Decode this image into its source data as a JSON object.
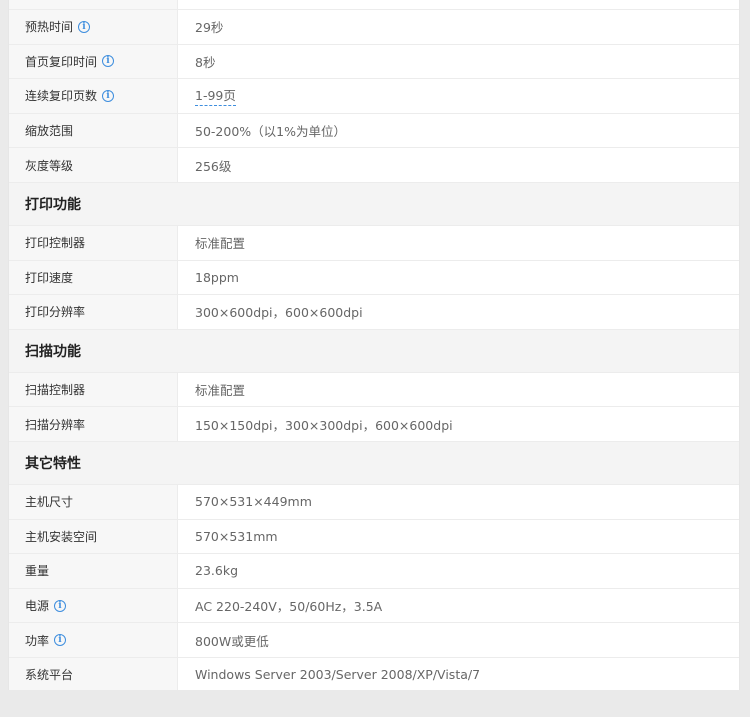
{
  "sections": {
    "copy_rows": [
      {
        "label": "预热时间",
        "value": "29秒",
        "info": true
      },
      {
        "label": "首页复印时间",
        "value": "8秒",
        "info": true
      },
      {
        "label": "连续复印页数",
        "value": "1-99页",
        "info": true
      },
      {
        "label": "缩放范围",
        "value": "50-200%（以1%为单位）",
        "info": false
      },
      {
        "label": "灰度等级",
        "value": "256级",
        "info": false
      }
    ],
    "print_title": "打印功能",
    "print_rows": [
      {
        "label": "打印控制器",
        "value": "标准配置"
      },
      {
        "label": "打印速度",
        "value": "18ppm"
      },
      {
        "label": "打印分辨率",
        "value": "300×600dpi，600×600dpi"
      }
    ],
    "scan_title": "扫描功能",
    "scan_rows": [
      {
        "label": "扫描控制器",
        "value": "标准配置"
      },
      {
        "label": "扫描分辨率",
        "value": "150×150dpi，300×300dpi，600×600dpi"
      }
    ],
    "other_title": "其它特性",
    "other_rows": [
      {
        "label": "主机尺寸",
        "value": "570×531×449mm",
        "info": false
      },
      {
        "label": "主机安装空间",
        "value": "570×531mm",
        "info": false
      },
      {
        "label": "重量",
        "value": "23.6kg",
        "info": false
      },
      {
        "label": "电源",
        "value": "AC 220-240V，50/60Hz，3.5A",
        "info": true
      },
      {
        "label": "功率",
        "value": "800W或更低",
        "info": true
      },
      {
        "label": "系统平台",
        "value": "Windows Server 2003/Server 2008/XP/Vista/7",
        "info": false
      }
    ]
  },
  "icons": {
    "info": "info-circle-icon",
    "info_glyph": "i"
  },
  "colors": {
    "accent": "#3e8ede",
    "label_bg": "#f7f7f7",
    "section_bg": "#f4f4f4"
  }
}
